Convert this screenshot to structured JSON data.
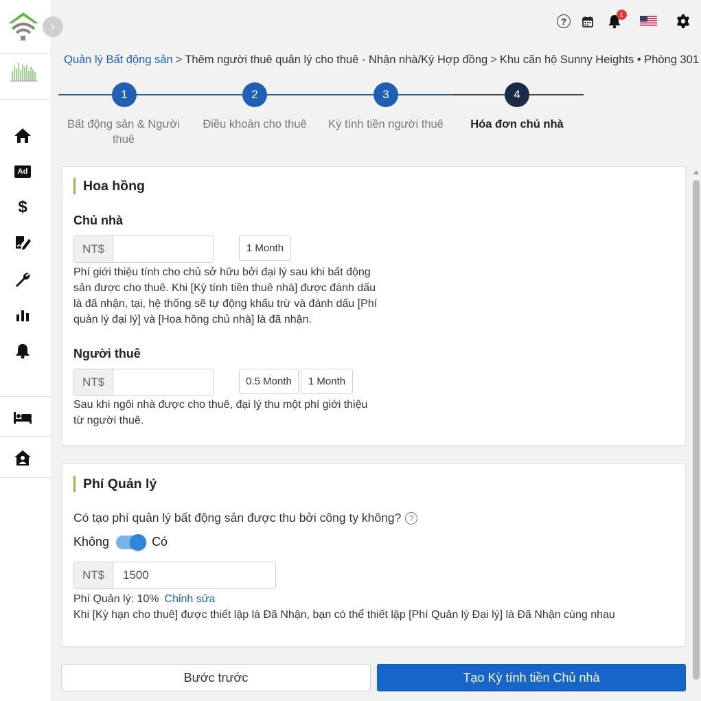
{
  "sidebar": {
    "expand_glyph": "›",
    "icons": [
      "home-icon",
      "ad-icon",
      "dollar-icon",
      "contract-icon",
      "wrench-icon",
      "chart-icon",
      "bell-icon",
      "bed-icon",
      "house-user-icon"
    ],
    "ad_label": "Ad",
    "dollar_glyph": "$"
  },
  "topbar": {
    "notification_count": "1",
    "help_glyph": "?"
  },
  "breadcrumb": {
    "items": [
      "Quản lý Bất động sản",
      "Thêm người thuê quản lý cho thuê - Nhận nhà/Ký Hợp đồng",
      "Khu căn hộ Sunny Heights • Phòng 301"
    ],
    "separator": ">"
  },
  "steps": [
    {
      "number": "1",
      "label": "Bất động sản & Người thuê"
    },
    {
      "number": "2",
      "label": "Điều khoản cho thuê"
    },
    {
      "number": "3",
      "label": "Kỳ tính tiền người thuê"
    },
    {
      "number": "4",
      "label": "Hóa đơn chủ nhà"
    }
  ],
  "commission": {
    "title": "Hoa hồng",
    "landlord": {
      "label": "Chủ nhà",
      "currency": "NT$",
      "value": "",
      "chips": [
        "1 Month"
      ],
      "description": "Phí giới thiệu tính cho chủ sở hữu bởi đại lý sau khi bất động sản được cho thuê. Khi [Kỳ tính tiền thuê nhà] được đánh dấu là đã nhận, tại, hệ thống sẽ tự động khấu trừ và đánh dấu [Phí quản lý đại lý] và [Hoa hồng chủ nhà] là đã nhận."
    },
    "tenant": {
      "label": "Người thuê",
      "currency": "NT$",
      "value": "",
      "chips": [
        "0.5 Month",
        "1 Month"
      ],
      "description": "Sau khi ngôi nhà được cho thuê, đại lý thu một phí giới thiệu từ người thuê."
    }
  },
  "management": {
    "title": "Phí Quản lý",
    "question": "Có tạo phí quản lý bất động sản được thu bởi công ty không?",
    "toggle_off_label": "Không",
    "toggle_on_label": "Có",
    "toggle_on": true,
    "currency": "NT$",
    "value": "1500",
    "fee_text": "Phí Quản lý: 10%",
    "edit_label": "Chỉnh sửa",
    "note": "Khi [Kỳ hạn cho thuê] được thiết lập là Đã Nhận, bạn có thể thiết lập [Phí Quản lý Đại lý] là Đã Nhận cùng nhau"
  },
  "actions": {
    "prev_label": "Bước trước",
    "create_label": "Tạo Kỳ tính tiền Chủ nhà"
  },
  "colors": {
    "primary": "#1765c8",
    "step_done": "#1f5fb4",
    "step_active": "#1a2b45",
    "accent_green": "#8bc34a",
    "link": "#1f5fb4",
    "badge": "#e53935"
  }
}
